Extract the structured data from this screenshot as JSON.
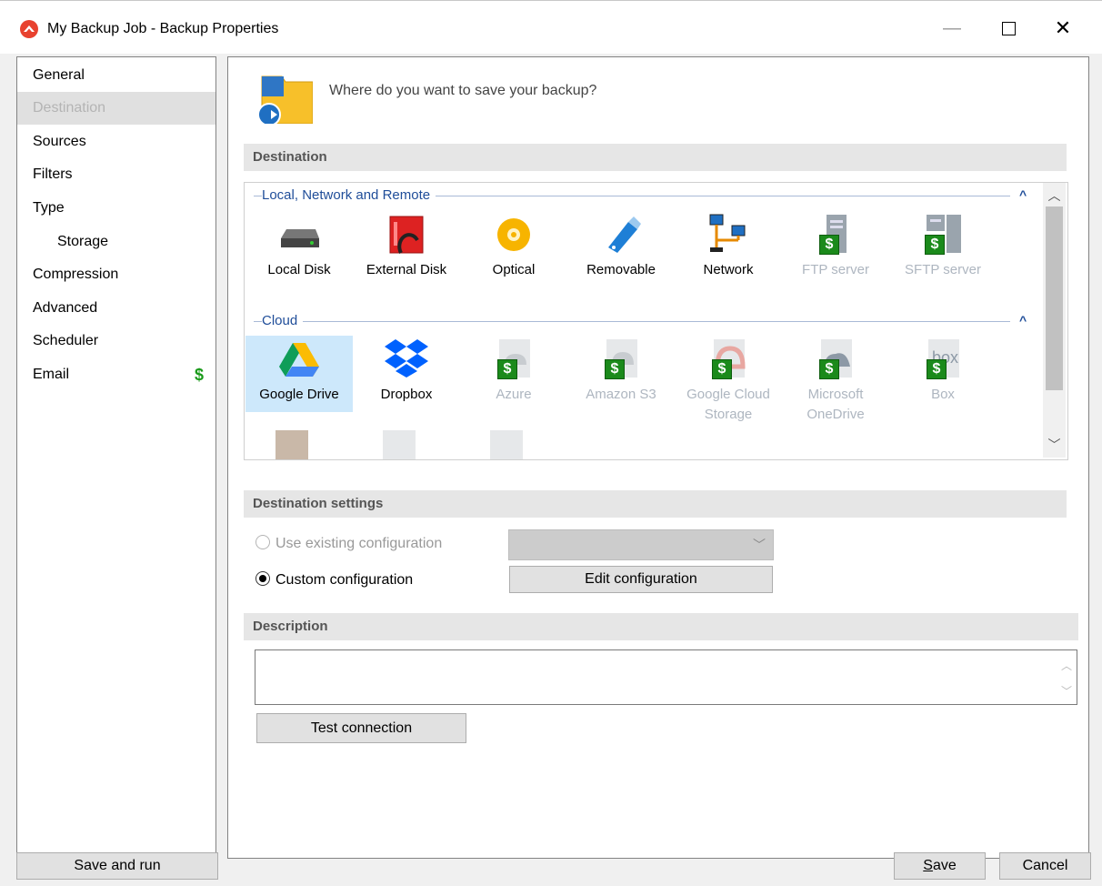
{
  "window": {
    "title": "My Backup Job - Backup Properties",
    "minimize_glyph": "—",
    "close_glyph": "✕"
  },
  "sidebar": {
    "items": [
      {
        "label": "General"
      },
      {
        "label": "Destination",
        "selected": true
      },
      {
        "label": "Sources"
      },
      {
        "label": "Filters"
      },
      {
        "label": "Type"
      },
      {
        "label": "Storage",
        "indent": true
      },
      {
        "label": "Compression"
      },
      {
        "label": "Advanced"
      },
      {
        "label": "Scheduler"
      },
      {
        "label": "Email",
        "badge": "$"
      }
    ]
  },
  "header": {
    "question": "Where do you want to save your backup?",
    "icon": "folder-arrow-icon"
  },
  "destination": {
    "section_title": "Destination",
    "groups": [
      {
        "title": "Local, Network and Remote",
        "collapse_glyph": "^",
        "items": [
          {
            "label": "Local Disk",
            "icon": "hard-disk-icon",
            "enabled": true
          },
          {
            "label": "External Disk",
            "icon": "external-disk-icon",
            "enabled": true
          },
          {
            "label": "Optical",
            "icon": "optical-disc-icon",
            "enabled": true
          },
          {
            "label": "Removable",
            "icon": "usb-drive-icon",
            "enabled": true
          },
          {
            "label": "Network",
            "icon": "network-icon",
            "enabled": true
          },
          {
            "label": "FTP server",
            "icon": "ftp-server-icon",
            "enabled": false,
            "paid": true
          },
          {
            "label": "SFTP server",
            "icon": "sftp-server-icon",
            "enabled": false,
            "paid": true
          }
        ]
      },
      {
        "title": "Cloud",
        "collapse_glyph": "^",
        "items": [
          {
            "label": "Google Drive",
            "icon": "google-drive-icon",
            "enabled": true,
            "selected": true
          },
          {
            "label": "Dropbox",
            "icon": "dropbox-icon",
            "enabled": true
          },
          {
            "label": "Azure",
            "icon": "azure-icon",
            "enabled": false,
            "paid": true
          },
          {
            "label": "Amazon S3",
            "icon": "amazon-s3-icon",
            "enabled": false,
            "paid": true
          },
          {
            "label": "Google Cloud Storage",
            "icon": "google-cloud-icon",
            "enabled": false,
            "paid": true
          },
          {
            "label": "Microsoft OneDrive",
            "icon": "onedrive-icon",
            "enabled": false,
            "paid": true
          },
          {
            "label": "Box",
            "icon": "box-icon",
            "enabled": false,
            "paid": true
          }
        ]
      }
    ]
  },
  "destination_settings": {
    "section_title": "Destination settings",
    "use_existing_label": "Use existing configuration",
    "custom_label": "Custom configuration",
    "selected_option": "custom",
    "edit_config_label": "Edit configuration"
  },
  "description": {
    "section_title": "Description",
    "value": "",
    "test_connection_label": "Test connection"
  },
  "footer": {
    "save_and_run_label": "Save and run",
    "save_label": "Save",
    "save_accel": "S",
    "save_rest": "ave",
    "cancel_label": "Cancel"
  },
  "colors": {
    "paid_green": "#1b8a1b",
    "group_title_blue": "#1f4d99",
    "selection_blue": "#cde8fb",
    "brand_red": "#e8422f"
  }
}
